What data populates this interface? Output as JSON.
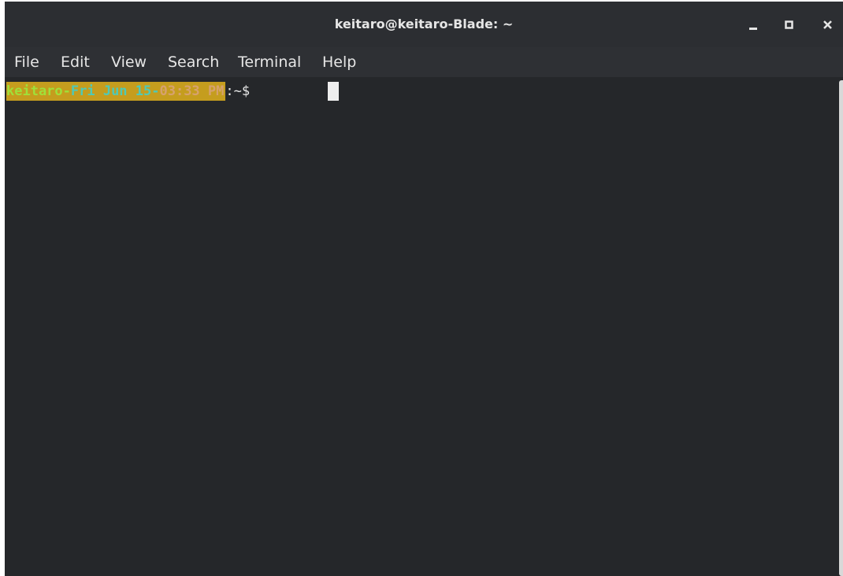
{
  "window": {
    "title": "keitaro@keitaro-Blade: ~"
  },
  "controls": {
    "minimize_icon": "minimize-icon",
    "maximize_icon": "maximize-icon",
    "close_icon": "close-icon"
  },
  "menu": {
    "items": [
      "File",
      "Edit",
      "View",
      "Search",
      "Terminal",
      "Help"
    ]
  },
  "terminal": {
    "prompt_user": "keitaro-",
    "prompt_date": "Fri Jun 15-",
    "prompt_time": "03:33 PM",
    "prompt_suffix": ":~$ "
  },
  "colors": {
    "prompt_highlight": "#c59d1e",
    "user": "#9fe03a",
    "date": "#4fc9b6",
    "time": "#d6a26e",
    "background": "#25272a"
  }
}
